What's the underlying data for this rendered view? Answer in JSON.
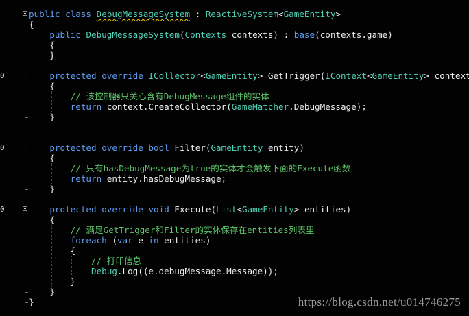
{
  "editor": {
    "lines": [
      {
        "mark": "",
        "fold": "open",
        "parts": [
          [
            "kw",
            "public"
          ],
          [
            "plain",
            " "
          ],
          [
            "kw",
            "class"
          ],
          [
            "plain",
            " "
          ],
          [
            "type-squiggle",
            "DebugMessageSystem"
          ],
          [
            "plain",
            " : "
          ],
          [
            "type",
            "ReactiveSystem"
          ],
          [
            "plain",
            "<"
          ],
          [
            "type",
            "GameEntity"
          ],
          [
            "plain",
            ">"
          ]
        ]
      },
      {
        "mark": "",
        "fold": "",
        "parts": [
          [
            "plain",
            "{"
          ]
        ]
      },
      {
        "mark": "",
        "fold": "",
        "parts": [
          [
            "plain",
            "    "
          ],
          [
            "kw",
            "public"
          ],
          [
            "plain",
            " "
          ],
          [
            "type",
            "DebugMessageSystem"
          ],
          [
            "plain",
            "("
          ],
          [
            "type",
            "Contexts"
          ],
          [
            "plain",
            " contexts) : "
          ],
          [
            "kw",
            "base"
          ],
          [
            "plain",
            "(contexts.game)"
          ]
        ]
      },
      {
        "mark": "",
        "fold": "",
        "parts": [
          [
            "plain",
            "    {"
          ]
        ]
      },
      {
        "mark": "",
        "fold": "",
        "parts": [
          [
            "plain",
            "    }"
          ]
        ]
      },
      {
        "mark": "",
        "fold": "",
        "parts": [
          [
            "plain",
            ""
          ]
        ]
      },
      {
        "mark": "0",
        "fold": "open",
        "parts": [
          [
            "plain",
            "    "
          ],
          [
            "kw",
            "protected"
          ],
          [
            "plain",
            " "
          ],
          [
            "kw",
            "override"
          ],
          [
            "plain",
            " "
          ],
          [
            "type",
            "ICollector"
          ],
          [
            "plain",
            "<"
          ],
          [
            "type",
            "GameEntity"
          ],
          [
            "plain",
            "> GetTrigger("
          ],
          [
            "type",
            "IContext"
          ],
          [
            "plain",
            "<"
          ],
          [
            "type",
            "GameEntity"
          ],
          [
            "plain",
            "> context)"
          ]
        ]
      },
      {
        "mark": "",
        "fold": "",
        "parts": [
          [
            "plain",
            "    {"
          ]
        ]
      },
      {
        "mark": "",
        "fold": "",
        "parts": [
          [
            "plain",
            "        "
          ],
          [
            "cmt",
            "// 该控制器只关心含有DebugMessage组件的实体"
          ]
        ]
      },
      {
        "mark": "",
        "fold": "",
        "parts": [
          [
            "plain",
            "        "
          ],
          [
            "kw",
            "return"
          ],
          [
            "plain",
            " context.CreateCollector("
          ],
          [
            "type",
            "GameMatcher"
          ],
          [
            "plain",
            ".DebugMessage);"
          ]
        ]
      },
      {
        "mark": "",
        "fold": "",
        "parts": [
          [
            "plain",
            "    }"
          ]
        ]
      },
      {
        "mark": "",
        "fold": "",
        "parts": [
          [
            "plain",
            ""
          ]
        ]
      },
      {
        "mark": "",
        "fold": "",
        "parts": [
          [
            "plain",
            ""
          ]
        ]
      },
      {
        "mark": "0",
        "fold": "open",
        "parts": [
          [
            "plain",
            "    "
          ],
          [
            "kw",
            "protected"
          ],
          [
            "plain",
            " "
          ],
          [
            "kw",
            "override"
          ],
          [
            "plain",
            " "
          ],
          [
            "kw",
            "bool"
          ],
          [
            "plain",
            " Filter("
          ],
          [
            "type",
            "GameEntity"
          ],
          [
            "plain",
            " entity)"
          ]
        ]
      },
      {
        "mark": "",
        "fold": "",
        "parts": [
          [
            "plain",
            "    {"
          ]
        ]
      },
      {
        "mark": "",
        "fold": "",
        "parts": [
          [
            "plain",
            "        "
          ],
          [
            "cmt",
            "// 只有hasDebugMessage为true的实体才会触发下面的Execute函数"
          ]
        ]
      },
      {
        "mark": "",
        "fold": "",
        "parts": [
          [
            "plain",
            "        "
          ],
          [
            "kw",
            "return"
          ],
          [
            "plain",
            " entity.hasDebugMessage;"
          ]
        ]
      },
      {
        "mark": "",
        "fold": "",
        "parts": [
          [
            "plain",
            "    }"
          ]
        ]
      },
      {
        "mark": "",
        "fold": "",
        "parts": [
          [
            "plain",
            ""
          ]
        ]
      },
      {
        "mark": "0",
        "fold": "open",
        "parts": [
          [
            "plain",
            "    "
          ],
          [
            "kw",
            "protected"
          ],
          [
            "plain",
            " "
          ],
          [
            "kw",
            "override"
          ],
          [
            "plain",
            " "
          ],
          [
            "kw",
            "void"
          ],
          [
            "plain",
            " Execute("
          ],
          [
            "type",
            "List"
          ],
          [
            "plain",
            "<"
          ],
          [
            "type",
            "GameEntity"
          ],
          [
            "plain",
            "> entities)"
          ]
        ]
      },
      {
        "mark": "",
        "fold": "",
        "parts": [
          [
            "plain",
            "    {"
          ]
        ]
      },
      {
        "mark": "",
        "fold": "",
        "parts": [
          [
            "plain",
            "        "
          ],
          [
            "cmt",
            "// 满足GetTrigger和Filter的实体保存在entities列表里"
          ]
        ]
      },
      {
        "mark": "",
        "fold": "",
        "parts": [
          [
            "plain",
            "        "
          ],
          [
            "kw",
            "foreach"
          ],
          [
            "plain",
            " ("
          ],
          [
            "kw",
            "var"
          ],
          [
            "plain",
            " e "
          ],
          [
            "kw",
            "in"
          ],
          [
            "plain",
            " entities)"
          ]
        ]
      },
      {
        "mark": "",
        "fold": "",
        "parts": [
          [
            "plain",
            "        {"
          ]
        ]
      },
      {
        "mark": "",
        "fold": "",
        "parts": [
          [
            "plain",
            "            "
          ],
          [
            "cmt",
            "// 打印信息"
          ]
        ]
      },
      {
        "mark": "",
        "fold": "",
        "parts": [
          [
            "plain",
            "            "
          ],
          [
            "type",
            "Debug"
          ],
          [
            "plain",
            ".Log((e.debugMessage.Message));"
          ]
        ]
      },
      {
        "mark": "",
        "fold": "",
        "parts": [
          [
            "plain",
            "        }"
          ]
        ]
      },
      {
        "mark": "",
        "fold": "",
        "parts": [
          [
            "plain",
            "    }"
          ]
        ]
      },
      {
        "mark": "",
        "fold": "",
        "parts": [
          [
            "plain",
            "}"
          ]
        ]
      }
    ]
  },
  "watermark": "https://blog.csdn.net/u014746275",
  "colors": {
    "background": "#020202",
    "keyword": "#5d9cf0",
    "type": "#4fd1b6",
    "comment": "#5cc46a",
    "text": "#ececec",
    "squiggle": "#ffd200"
  }
}
